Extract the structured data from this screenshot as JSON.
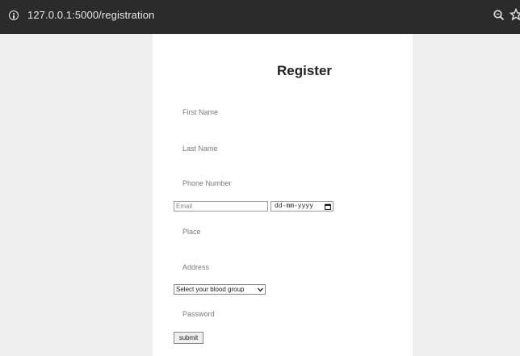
{
  "browser": {
    "url": "127.0.0.1:5000/registration",
    "icons": [
      "info-icon",
      "zoom-icon",
      "star-icon"
    ]
  },
  "form": {
    "title": "Register",
    "first_name_placeholder": "First Name",
    "last_name_placeholder": "Last Name",
    "phone_placeholder": "Phone Number",
    "email_placeholder": "Email",
    "date_value": "dd-mm-yyyy",
    "place_placeholder": "Place",
    "address_placeholder": "Address",
    "blood_group_selected": "Select your blood group",
    "password_placeholder": "Password",
    "submit_label": "submit"
  }
}
